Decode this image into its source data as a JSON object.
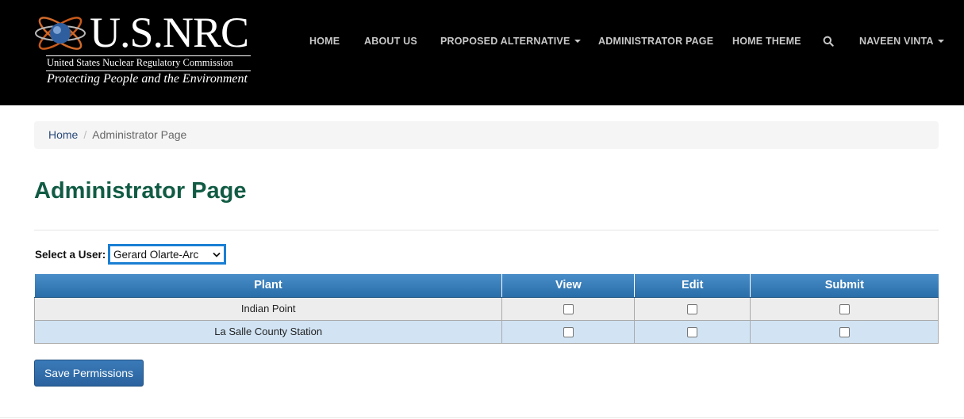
{
  "brand": {
    "wordmark": "U.S.NRC",
    "full_name": "United States Nuclear Regulatory Commission",
    "tagline": "Protecting People and the Environment",
    "logo_icon": "atom-globe-icon"
  },
  "nav": {
    "items": [
      {
        "label": "HOME",
        "dropdown": false
      },
      {
        "label": "ABOUT US",
        "dropdown": false
      },
      {
        "label": "PROPOSED ALTERNATIVE",
        "dropdown": true
      },
      {
        "label": "ADMINISTRATOR PAGE",
        "dropdown": false
      },
      {
        "label": "HOME THEME",
        "dropdown": false
      }
    ],
    "search_icon": "search-icon",
    "user_menu": {
      "label": "NAVEEN VINTA",
      "dropdown": true
    }
  },
  "breadcrumb": {
    "home": "Home",
    "separator": "/",
    "current": "Administrator Page"
  },
  "page": {
    "title": "Administrator Page"
  },
  "user_select": {
    "label": "Select a User:",
    "selected": "Gerard Olarte-Arc"
  },
  "permissions_table": {
    "headers": [
      "Plant",
      "View",
      "Edit",
      "Submit"
    ],
    "rows": [
      {
        "plant": "Indian Point",
        "view": false,
        "edit": false,
        "submit": false
      },
      {
        "plant": "La Salle County Station",
        "view": false,
        "edit": false,
        "submit": false
      }
    ]
  },
  "actions": {
    "save_label": "Save Permissions"
  },
  "colors": {
    "header_bg": "#000000",
    "title_green": "#115b44",
    "table_header_blue": "#3a7ebd",
    "row_alt_blue": "#d2e4f4",
    "button_blue": "#2f6ba8",
    "select_focus": "#1a7fd4"
  }
}
